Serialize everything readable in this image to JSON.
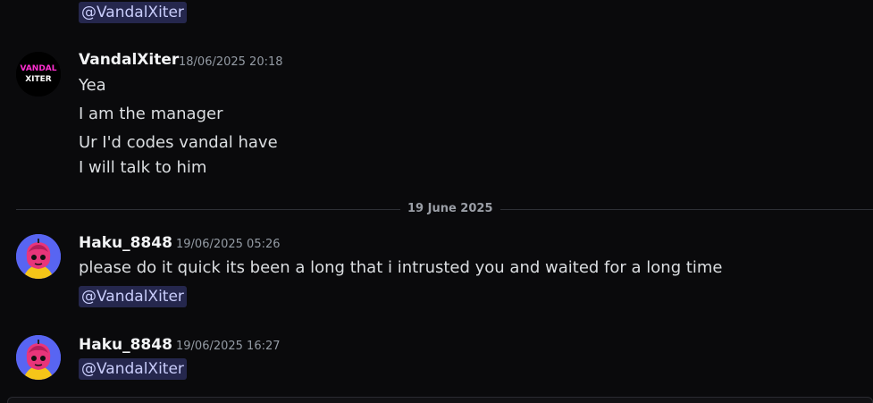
{
  "top_mention": "@VandalXiter",
  "messages": [
    {
      "author": "VandalXiter",
      "timestamp": "18/06/2025 20:18",
      "avatar_text": [
        "VANDAL",
        "XITER"
      ],
      "lines": [
        "Yea",
        "I am the manager",
        "Ur I'd codes vandal have",
        "I will talk to him"
      ]
    },
    {
      "author": "Haku_8848",
      "timestamp": "19/06/2025 05:26",
      "lines": [
        "please do it quick its been a long that i intrusted you and waited for a long time"
      ],
      "mention": "@VandalXiter"
    },
    {
      "author": "Haku_8848",
      "timestamp": "19/06/2025 16:27",
      "mention": "@VandalXiter"
    }
  ],
  "date_divider": "19 June 2025",
  "colors": {
    "background": "#0a0a0c",
    "mention_bg": "#25274d",
    "mention_text": "#c9cdfb",
    "author": "#f2f3f5",
    "timestamp": "#949ba4",
    "haku_avatar_bg": "#5865f2",
    "vandal_accent": "#ff2fd1"
  }
}
